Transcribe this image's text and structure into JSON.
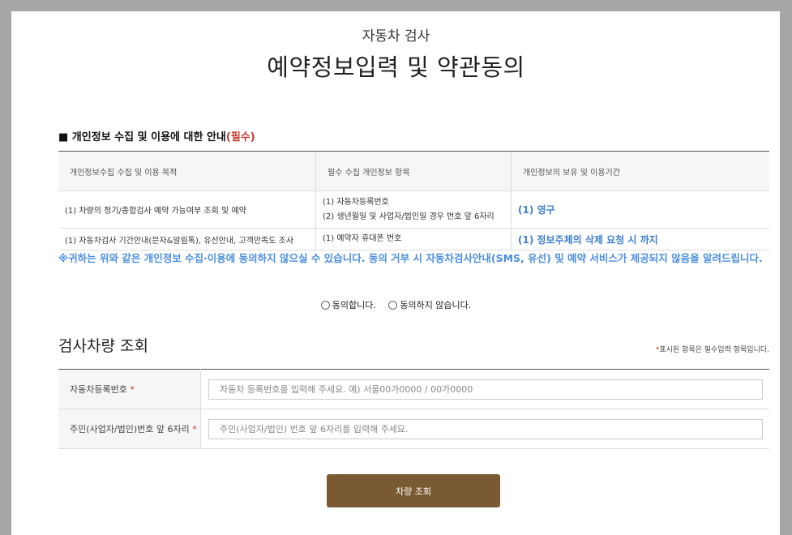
{
  "header": {
    "subtitle": "자동차 검사",
    "title": "예약정보입력 및 약관동의"
  },
  "privacy": {
    "section_title": "■ 개인정보 수집 및 이용에 대한 안내",
    "required_tag": "(필수)",
    "columns": [
      "개인정보수집 수집 및 이용 목적",
      "필수 수집 개인정보 항목",
      "개인정보의 보유 및 이용기간"
    ],
    "rows": [
      {
        "purpose": "(1) 차량의 정기/종합검사 예약 가능여부 조회 및 예약",
        "items": [
          "(1) 자동차등록번호",
          "(2) 생년월일 및 사업자/법인일 경우 번호 앞 6자리"
        ],
        "period": "(1) 영구"
      },
      {
        "purpose": "(1) 자동차검사 기간안내(문자&알림톡), 유선안내, 고객만족도 조사",
        "items": [
          "(1) 예약자 휴대폰 번호"
        ],
        "period": "(1) 정보주체의 삭제 요청 시 까지"
      }
    ],
    "notice": "※귀하는 위와 같은 개인정보 수집·이용에 동의하지 않으실 수 있습니다. 동의 거부 시 자동차검사안내(SMS, 유선) 및 예약 서비스가 제공되지 않음을 알려드립니다.",
    "agree_label": "동의합니다.",
    "disagree_label": "동의하지 않습니다."
  },
  "lookup": {
    "title": "검사차량 조회",
    "required_note_star": "*",
    "required_note": "표시된 항목은 필수입력 항목입니다.",
    "fields": [
      {
        "label": "자동차등록번호",
        "star": "*",
        "placeholder": "자동차 등록번호를 입력해 주세요. 예) 서울00가0000 / 00가0000"
      },
      {
        "label": "주민(사업자/법인)번호 앞 6자리",
        "star": "*",
        "placeholder": "주민(사업자/법인) 번호 앞 6자리를 입력해 주세요."
      }
    ],
    "submit_label": "차량 조회"
  },
  "colors": {
    "accent_blue": "#4a8ee0",
    "required_red": "#c0392b",
    "button_brown": "#7a5a33"
  }
}
